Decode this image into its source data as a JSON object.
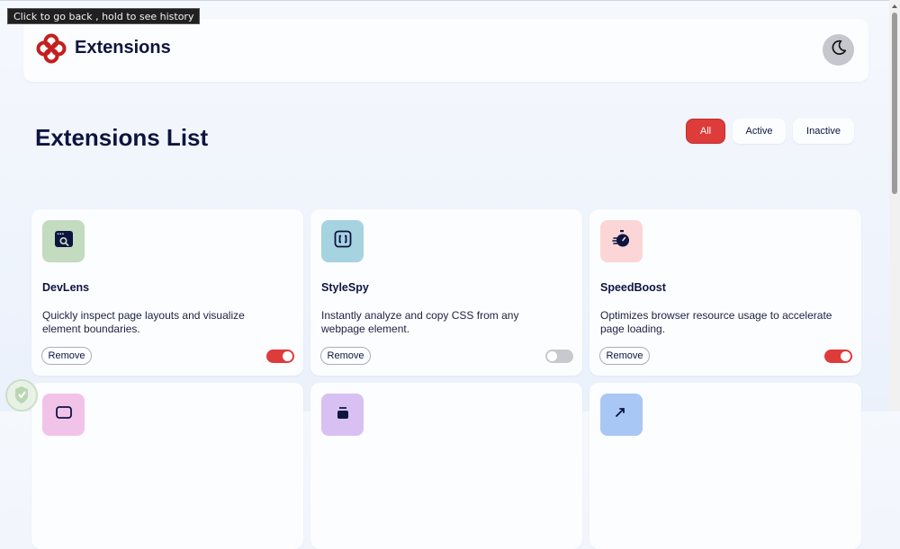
{
  "tooltip": "Click to go back , hold to see history",
  "header": {
    "brand": "Extensions"
  },
  "page_title": "Extensions List",
  "filters": [
    "All",
    "Active",
    "Inactive"
  ],
  "colors": {
    "accent": "#de3b3b",
    "title": "#0d1440",
    "toggle_off": "#c7c9cf"
  },
  "extensions": [
    {
      "name": "DevLens",
      "description": "Quickly inspect page layouts and visualize element boundaries.",
      "remove_label": "Remove",
      "active": true,
      "icon": "devlens-inspect-icon",
      "icon_bg": "#c3dbbf"
    },
    {
      "name": "StyleSpy",
      "description": "Instantly analyze and copy CSS from any webpage element.",
      "remove_label": "Remove",
      "active": false,
      "icon": "stylespy-brackets-icon",
      "icon_bg": "#a6d3e0"
    },
    {
      "name": "SpeedBoost",
      "description": "Optimizes browser resource usage to accelerate page loading.",
      "remove_label": "Remove",
      "active": true,
      "icon": "speedboost-stopwatch-icon",
      "icon_bg": "#fcd6d6"
    }
  ],
  "next_row_icons": [
    {
      "icon": "partial-icon",
      "icon_bg": "#f2c3e8"
    },
    {
      "icon": "partial-icon",
      "icon_bg": "#d8c0f2"
    },
    {
      "icon": "partial-icon",
      "icon_bg": "#a8c7f5"
    }
  ]
}
